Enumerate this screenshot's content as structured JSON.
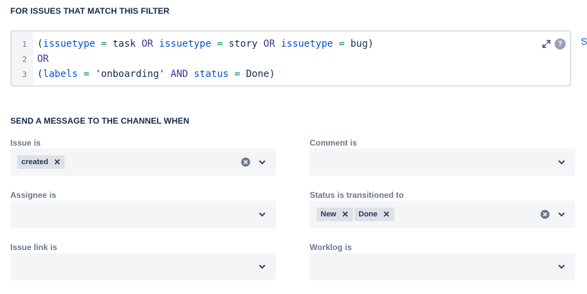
{
  "filter": {
    "section_title": "FOR ISSUES THAT MATCH THIS FILTER",
    "line_numbers": [
      "1",
      "2",
      "3"
    ],
    "line1": {
      "p1": "(",
      "f1": "issuetype",
      "e1": " = ",
      "v1": "task",
      "o1": " OR ",
      "f2": "issuetype",
      "e2": " = ",
      "v2": "story",
      "o2": " OR ",
      "f3": "issuetype",
      "e3": " = ",
      "v3": "bug",
      "p2": ")"
    },
    "line2": {
      "o1": "OR"
    },
    "line3": {
      "p1": "(",
      "f1": "labels",
      "e1": " = ",
      "v1": "'onboarding'",
      "o1": " AND ",
      "f2": "status",
      "e2": " = ",
      "v2": "Done",
      "p2": ")"
    },
    "help_label": "?",
    "side_link_label": "S"
  },
  "send": {
    "section_title": "SEND A MESSAGE TO THE CHANNEL WHEN",
    "issue_is": {
      "label": "Issue is",
      "chips": [
        "created"
      ]
    },
    "comment_is": {
      "label": "Comment is"
    },
    "assignee_is": {
      "label": "Assignee is"
    },
    "status_transitioned": {
      "label": "Status is transitioned to",
      "chips": [
        "New",
        "Done"
      ]
    },
    "issue_link_is": {
      "label": "Issue link is"
    },
    "worklog_is": {
      "label": "Worklog is"
    }
  },
  "icons": {
    "expand": "expand-icon",
    "help": "help-icon",
    "clear": "clear-icon",
    "chevron": "chevron-down-icon",
    "remove": "close-icon"
  },
  "colors": {
    "field": "#0052cc",
    "operator": "#403294",
    "equals": "#00875a",
    "select_bg": "#f4f5f7",
    "chip_bg": "#dfe1e6"
  }
}
